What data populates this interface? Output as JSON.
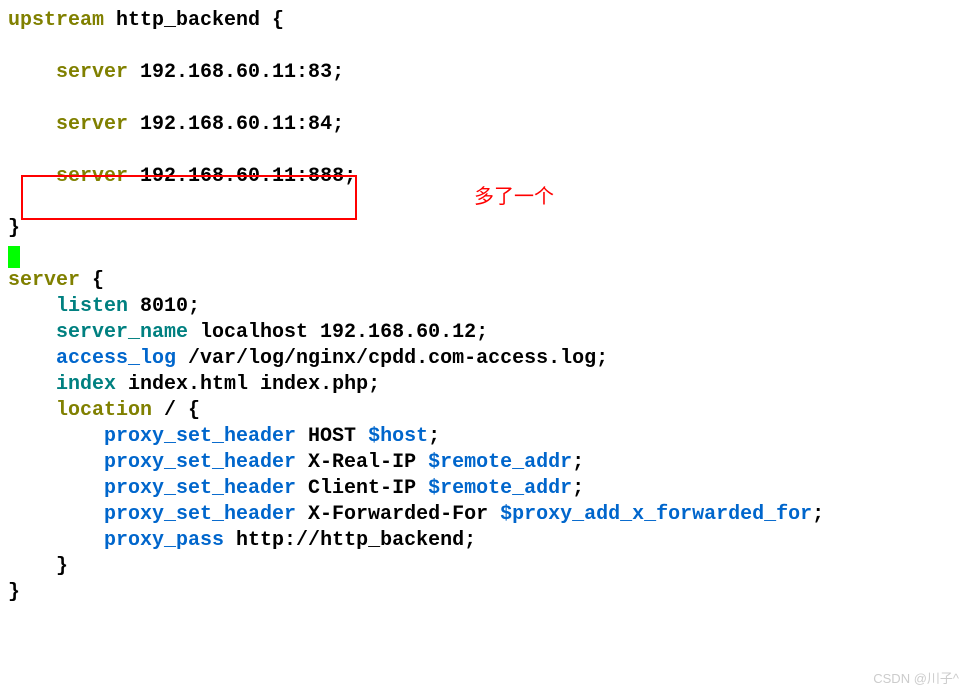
{
  "annotation": "多了一个",
  "watermark": "CSDN @川子^",
  "code": {
    "l1_kw": "upstream",
    "l1_rest": " http_backend {",
    "l2_kw": "    server",
    "l2_rest": " 192.168.60.11:83;",
    "l3_kw": "    server",
    "l3_rest": " 192.168.60.11:84;",
    "l4_kw": "    server",
    "l4_rest": " 192.168.60.11:888;",
    "l5": "}",
    "l6_kw": "server",
    "l6_rest": " {",
    "l7_kw": "    listen",
    "l7_rest": " 8010;",
    "l8_kw": "    server_name",
    "l8_rest": " localhost 192.168.60.12;",
    "l9_kw": "    access_log",
    "l9_rest": " /var/log/nginx/cpdd.com-access.log;",
    "l10_kw": "    index",
    "l10_rest": " index.html index.php;",
    "l11_kw": "    location",
    "l11_rest": " / {",
    "l12_kw": "        proxy_set_header",
    "l12_mid": " HOST ",
    "l12_var": "$host",
    "l12_end": ";",
    "l13_kw": "        proxy_set_header",
    "l13_mid": " X-Real-IP ",
    "l13_var": "$remote_addr",
    "l13_end": ";",
    "l14_kw": "        proxy_set_header",
    "l14_mid": " Client-IP ",
    "l14_var": "$remote_addr",
    "l14_end": ";",
    "l15_kw": "        proxy_set_header",
    "l15_mid": " X-Forwarded-For ",
    "l15_var": "$proxy_add_x_forwarded_for",
    "l15_end": ";",
    "l16_kw": "        proxy_pass",
    "l16_rest": " http://http_backend;",
    "l17": "    }",
    "l18": "}"
  }
}
